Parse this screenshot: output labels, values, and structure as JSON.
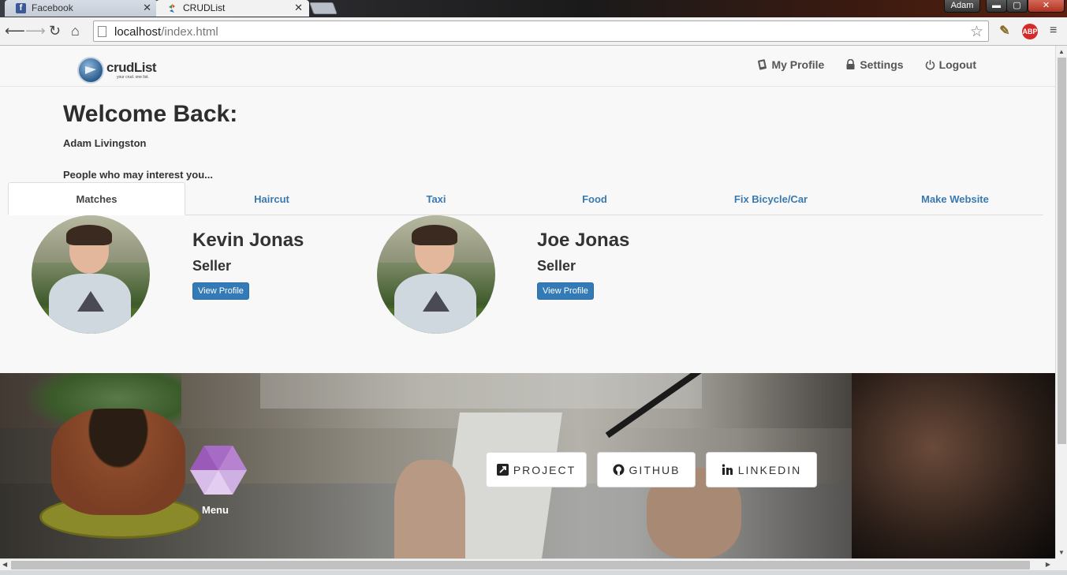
{
  "browser": {
    "tabs": [
      {
        "title": "Facebook",
        "active": false
      },
      {
        "title": "CRUDList",
        "active": true
      }
    ],
    "user_badge": "Adam",
    "url_host": "localhost",
    "url_path": "/index.html",
    "extension_abp": "ABP"
  },
  "site": {
    "logo_text": "crudList",
    "logo_tagline": "your crud. one list.",
    "nav": [
      {
        "label": "My Profile",
        "icon": "profile-icon"
      },
      {
        "label": "Settings",
        "icon": "lock-icon"
      },
      {
        "label": "Logout",
        "icon": "power-icon"
      }
    ]
  },
  "main": {
    "welcome": "Welcome Back:",
    "username": "Adam Livingston",
    "interest_text": "People who may interest you...",
    "tabs": [
      {
        "label": "Matches",
        "active": true
      },
      {
        "label": "Haircut",
        "active": false
      },
      {
        "label": "Taxi",
        "active": false
      },
      {
        "label": "Food",
        "active": false
      },
      {
        "label": "Fix Bicycle/Car",
        "active": false
      },
      {
        "label": "Make Website",
        "active": false
      }
    ],
    "people": [
      {
        "name": "Kevin Jonas",
        "role": "Seller",
        "button": "View Profile"
      },
      {
        "name": "Joe Jonas",
        "role": "Seller",
        "button": "View Profile"
      }
    ]
  },
  "hero": {
    "menu_label": "Menu",
    "buttons": [
      {
        "label": "PROJECT",
        "icon": "external-link-icon"
      },
      {
        "label": "GITHUB",
        "icon": "github-icon"
      },
      {
        "label": "LINKEDIN",
        "icon": "linkedin-icon"
      }
    ]
  },
  "colors": {
    "link": "#3a79b0",
    "button_primary": "#337ab7",
    "hex_menu": "#a66bc4"
  }
}
